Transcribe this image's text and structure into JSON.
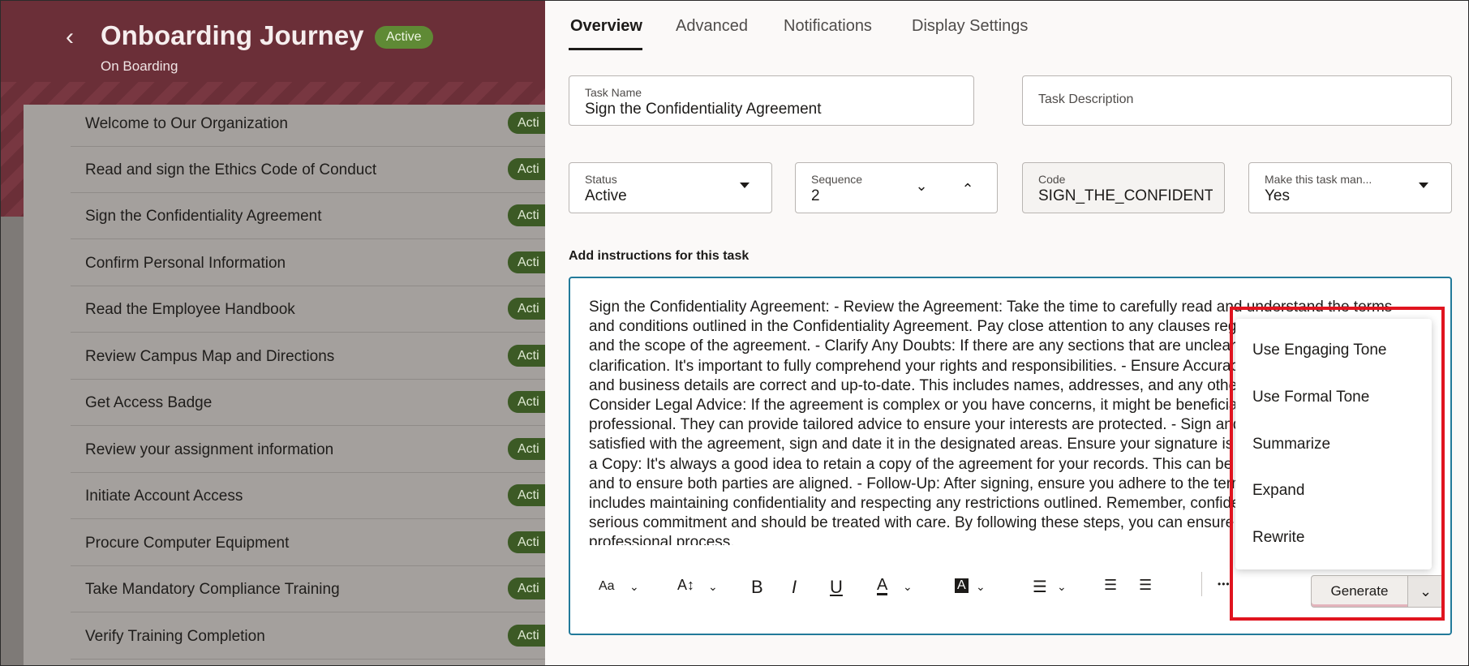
{
  "journey": {
    "title": "Onboarding Journey",
    "status_badge": "Active",
    "subtitle": "On Boarding"
  },
  "tasks": [
    {
      "name": "Welcome to Our Organization",
      "badge": "Acti"
    },
    {
      "name": "Read and sign the Ethics Code of Conduct",
      "badge": "Acti"
    },
    {
      "name": "Sign the Confidentiality Agreement",
      "badge": "Acti"
    },
    {
      "name": "Confirm Personal Information",
      "badge": "Acti"
    },
    {
      "name": "Read the Employee Handbook",
      "badge": "Acti"
    },
    {
      "name": "Review Campus Map and Directions",
      "badge": "Acti"
    },
    {
      "name": "Get Access Badge",
      "badge": "Acti"
    },
    {
      "name": "Review your assignment information",
      "badge": "Acti"
    },
    {
      "name": "Initiate Account Access",
      "badge": "Acti"
    },
    {
      "name": "Procure Computer Equipment",
      "badge": "Acti"
    },
    {
      "name": "Take Mandatory Compliance Training",
      "badge": "Acti"
    },
    {
      "name": "Verify Training Completion",
      "badge": "Acti"
    }
  ],
  "tabs": [
    "Overview",
    "Advanced",
    "Notifications",
    "Display Settings"
  ],
  "form": {
    "task_name_label": "Task Name",
    "task_name_value": "Sign the Confidentiality Agreement",
    "task_description_placeholder": "Task Description",
    "status_label": "Status",
    "status_value": "Active",
    "sequence_label": "Sequence",
    "sequence_value": "2",
    "code_label": "Code",
    "code_value": "SIGN_THE_CONFIDENTI",
    "mandatory_label": "Make this task man...",
    "mandatory_value": "Yes"
  },
  "instructions": {
    "label": "Add instructions for this task",
    "text": "Sign the Confidentiality Agreement: - Review the Agreement: Take the time to carefully read and understand the terms and conditions outlined in the Confidentiality Agreement. Pay close attention to any clauses regarding data protection, and the scope of the agreement. - Clarify Any Doubts: If there are any sections that are unclear, don't hesitate to seek clarification. It's important to fully comprehend your rights and responsibilities. - Ensure Accuracy: Check that all personal and business details are correct and up-to-date. This includes names, addresses, and any other relevant information. - Consider Legal Advice: If the agreement is complex or you have concerns, it might be beneficial to consult a legal professional. They can provide tailored advice to ensure your interests are protected. - Sign and Date: Once you're satisfied with the agreement, sign and date it in the designated areas. Ensure your signature is clear and legible. - Keep a Copy: It's always a good idea to retain a copy of the agreement for your records. This can be useful for future reference and to ensure both parties are aligned. - Follow-Up: After signing, ensure you adhere to the terms of the agreement. This includes maintaining confidentiality and respecting any restrictions outlined. Remember, confidentiality agreements are a serious commitment and should be treated with care. By following these steps, you can ensure a smooth and professional process."
  },
  "toolbar": {
    "font_glyph": "Aa",
    "font_size_glyph": "A↕",
    "bold_glyph": "B",
    "italic_glyph": "I",
    "underline_glyph": "U",
    "text_color_glyph": "A",
    "highlight_glyph": "A",
    "more_glyph": "•••",
    "generate_label": "Generate"
  },
  "generate_menu": [
    "Use Engaging Tone",
    "Use Formal Tone",
    "Summarize",
    "Expand",
    "Rewrite"
  ],
  "colors": {
    "header_bg": "#6b2f38",
    "active_badge": "#5f8a35",
    "focus_border": "#227a9a",
    "highlight_box": "#e0141f"
  }
}
